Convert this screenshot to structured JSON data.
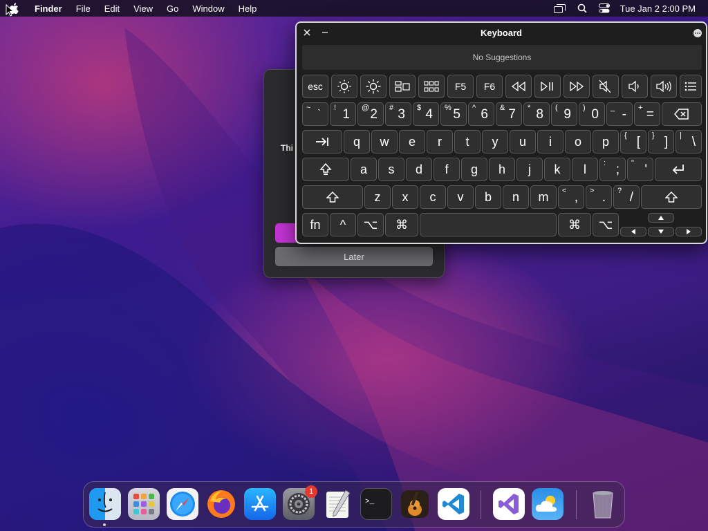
{
  "menubar": {
    "app_name": "Finder",
    "menus": [
      "File",
      "Edit",
      "View",
      "Go",
      "Window",
      "Help"
    ],
    "clock": "Tue Jan 2  2:00 PM"
  },
  "dialog": {
    "partial_text": "Thi",
    "later_label": "Later"
  },
  "keyboard": {
    "title": "Keyboard",
    "suggestions": "No Suggestions",
    "fn_row": [
      "esc",
      "F5",
      "F6"
    ],
    "rows": {
      "num": [
        [
          "~",
          "`"
        ],
        [
          "!",
          "1"
        ],
        [
          "@",
          "2"
        ],
        [
          "#",
          "3"
        ],
        [
          "$",
          "4"
        ],
        [
          "%",
          "5"
        ],
        [
          "^",
          "6"
        ],
        [
          "&",
          "7"
        ],
        [
          "*",
          "8"
        ],
        [
          "(",
          "9"
        ],
        [
          ")",
          "0"
        ],
        [
          "_",
          "-"
        ],
        [
          "+",
          "="
        ]
      ],
      "q": [
        "q",
        "w",
        "e",
        "r",
        "t",
        "y",
        "u",
        "i",
        "o",
        "p"
      ],
      "q_extra": [
        [
          "{",
          "["
        ],
        [
          "}",
          "]"
        ],
        [
          "|",
          "\\"
        ]
      ],
      "a": [
        "a",
        "s",
        "d",
        "f",
        "g",
        "h",
        "j",
        "k",
        "l"
      ],
      "a_extra": [
        [
          ":",
          ";"
        ],
        [
          "\"",
          "'"
        ]
      ],
      "z": [
        "z",
        "x",
        "c",
        "v",
        "b",
        "n",
        "m"
      ],
      "z_extra": [
        [
          "<",
          ","
        ],
        [
          ">",
          "."
        ],
        [
          "?",
          "/"
        ]
      ]
    },
    "bottom": {
      "fn": "fn",
      "ctrl": "^",
      "opt": "⌥",
      "cmd": "⌘"
    }
  },
  "dock": {
    "apps": [
      "Finder",
      "Launchpad",
      "Safari",
      "Firefox",
      "App Store",
      "System Settings",
      "TextEdit",
      "Terminal",
      "GarageBand",
      "Visual Studio Code",
      "Visual Studio",
      "Weather",
      "Trash"
    ],
    "settings_badge": "1"
  }
}
